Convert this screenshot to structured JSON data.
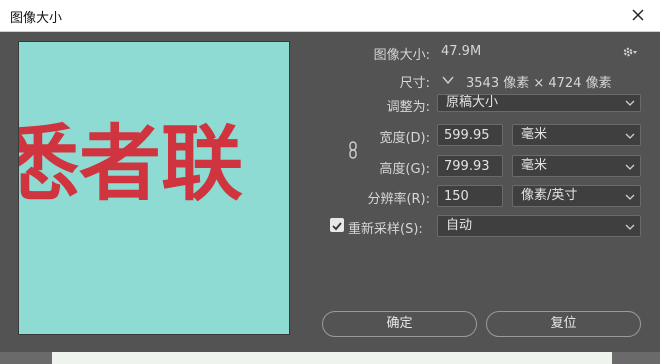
{
  "window": {
    "title": "图像大小"
  },
  "info": {
    "image_size_label": "图像大小:",
    "image_size_value": "47.9M",
    "dimensions_label": "尺寸:",
    "dimensions_value": "3543 像素  ×  4724 像素"
  },
  "fit_to": {
    "label": "调整为:",
    "value": "原稿大小"
  },
  "width": {
    "label": "宽度(D):",
    "value": "599.95",
    "unit": "毫米"
  },
  "height": {
    "label": "高度(G):",
    "value": "799.93",
    "unit": "毫米"
  },
  "resolution": {
    "label": "分辨率(R):",
    "value": "150",
    "unit": "像素/英寸"
  },
  "resample": {
    "label": "重新采样(S):",
    "checked": true,
    "value": "自动"
  },
  "buttons": {
    "ok": "确定",
    "reset": "复位"
  },
  "preview": {
    "text": "悉者联"
  },
  "colors": {
    "preview_bg": "#8ddbd2",
    "preview_text": "#d0343f",
    "dialog_bg": "#535353"
  }
}
